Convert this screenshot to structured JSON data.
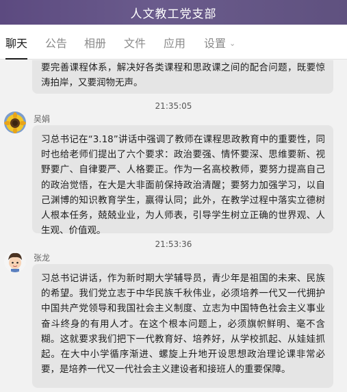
{
  "window": {
    "title": "人文教工党支部"
  },
  "tabs": [
    {
      "label": "聊天"
    },
    {
      "label": "公告"
    },
    {
      "label": "相册"
    },
    {
      "label": "文件"
    },
    {
      "label": "应用"
    },
    {
      "label": "设置"
    }
  ],
  "messages": [
    {
      "text": "要完善课程体系，解决好各类课程和思政课之间的配合问题，既要惊涛拍岸，又要润物无声。"
    },
    {
      "time": "21:35:05",
      "sender": "吴娟",
      "avatar_icon": "sunflower-avatar-icon",
      "text": "习总书记在“3.18”讲话中强调了教师在课程思政教育中的重要性，同时也给老师们提出了六个要求：政治要强、情怀要深、思维要新、视野要广、自律要严、人格要正。作为一名高校教师，要努力提高自己的政治觉悟，在大是大非面前保持政治清醒；要努力加强学习，以自己渊博的知识教育学生，赢得认同；此外，在教学过程中落实立德树人根本任务，兢兢业业，为人师表，引导学生树立正确的世界观、人生观、价值观。"
    },
    {
      "time": "21:53:36",
      "sender": "张龙",
      "avatar_icon": "cartoon-boy-avatar-icon",
      "text": "习总书记讲话，作为新时期大学辅导员，青少年是祖国的未来、民族的希望。我们党立志于中华民族千秋伟业，必须培养一代又一代拥护中国共产党领导和我国社会主义制度、立志为中国特色社会主义事业奋斗终身的有用人才。在这个根本问题上，必须旗帜鲜明、毫不含糊。这就要求我们把下一代教育好、培养好，从学校抓起、从娃娃抓起。在大中小学循序渐进、螺旋上升地开设思想政治理论课非常必要，是培养一代又一代社会主义建设者和接班人的重要保障。"
    }
  ]
}
